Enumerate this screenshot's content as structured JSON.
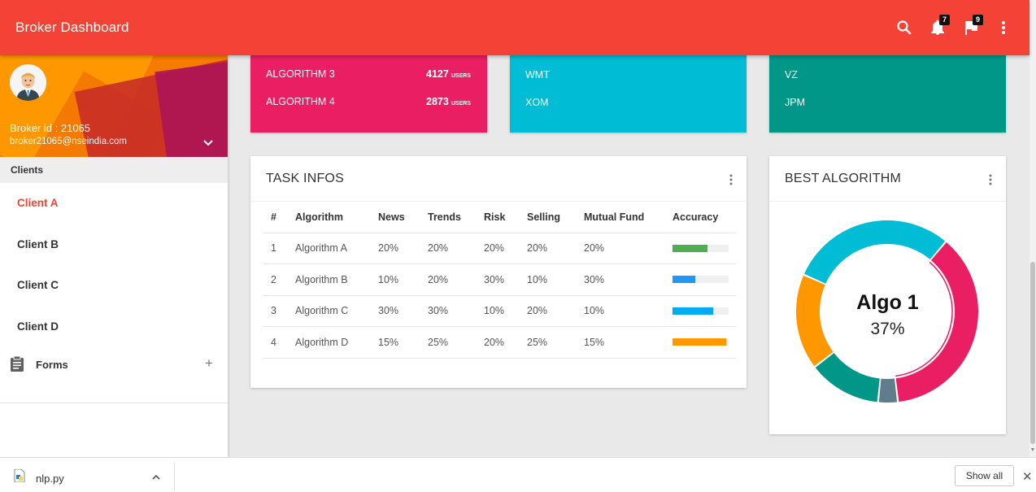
{
  "header": {
    "title": "Broker Dashboard",
    "notifications_count": "7",
    "flags_count": "9"
  },
  "sidebar": {
    "broker_id": "Broker id : 21065",
    "broker_email": "broker21065@nseindia.com",
    "clients_header": "Clients",
    "clients": [
      "Client A",
      "Client B",
      "Client C",
      "Client D"
    ],
    "forms_label": "Forms",
    "forms_toggle": "+"
  },
  "stat_cards": [
    {
      "color": "#e91e63",
      "rows": [
        {
          "label": "ALGORITHM 3",
          "value": "4127",
          "unit": "USERS"
        },
        {
          "label": "ALGORITHM 4",
          "value": "2873",
          "unit": "USERS"
        }
      ]
    },
    {
      "color": "#00bcd4",
      "rows": [
        {
          "label": "WMT"
        },
        {
          "label": "XOM"
        }
      ]
    },
    {
      "color": "#009688",
      "rows": [
        {
          "label": "VZ"
        },
        {
          "label": "JPM"
        }
      ]
    }
  ],
  "task_infos": {
    "title": "TASK INFOS",
    "columns": [
      "#",
      "Algorithm",
      "News",
      "Trends",
      "Risk",
      "Selling",
      "Mutual Fund",
      "Accuracy"
    ],
    "rows": [
      {
        "num": "1",
        "algorithm": "Algorithm A",
        "news": "20%",
        "trends": "20%",
        "risk": "20%",
        "selling": "20%",
        "mutual_fund": "20%",
        "accuracy": 0.62,
        "accuracy_color": "#4caf50"
      },
      {
        "num": "2",
        "algorithm": "Algorithm B",
        "news": "10%",
        "trends": "20%",
        "risk": "30%",
        "selling": "10%",
        "mutual_fund": "30%",
        "accuracy": 0.4,
        "accuracy_color": "#2196f3"
      },
      {
        "num": "3",
        "algorithm": "Algorithm C",
        "news": "30%",
        "trends": "30%",
        "risk": "10%",
        "selling": "20%",
        "mutual_fund": "10%",
        "accuracy": 0.73,
        "accuracy_color": "#03a9f4"
      },
      {
        "num": "4",
        "algorithm": "Algorithm D",
        "news": "15%",
        "trends": "25%",
        "risk": "20%",
        "selling": "25%",
        "mutual_fund": "15%",
        "accuracy": 0.95,
        "accuracy_color": "#ff9800"
      }
    ]
  },
  "best_algorithm": {
    "title": "BEST ALGORITHM",
    "center_label": "Algo 1",
    "center_value": "37%",
    "segments": [
      {
        "value": 37,
        "color": "#e91e63"
      },
      {
        "value": 3.5,
        "color": "#607d8b"
      },
      {
        "value": 13,
        "color": "#009688"
      },
      {
        "value": 17,
        "color": "#ff9800"
      },
      {
        "value": 29.5,
        "color": "#00bcd4"
      }
    ]
  },
  "download_bar": {
    "file_name": "nlp.py",
    "show_all": "Show all",
    "close": "✕"
  }
}
